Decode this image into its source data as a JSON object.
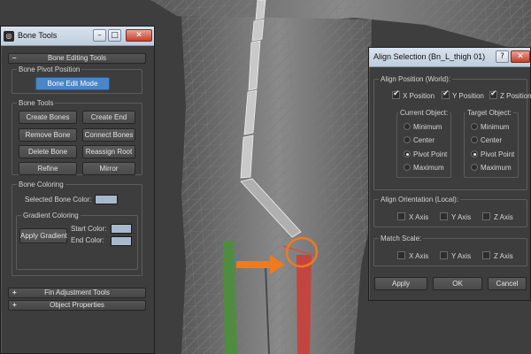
{
  "bone_tools": {
    "title": "Bone Tools",
    "rollout_bone_editing": "Bone Editing Tools",
    "pivot_group": "Bone Pivot Position",
    "bone_edit_mode": "Bone Edit Mode",
    "bone_tools_group": "Bone Tools",
    "create_bones": "Create Bones",
    "create_end": "Create End",
    "remove_bone": "Remove Bone",
    "connect_bones": "Connect Bones",
    "delete_bone": "Delete Bone",
    "reassign_root": "Reassign Root",
    "refine": "Refine",
    "mirror": "Mirror",
    "coloring_group": "Bone Coloring",
    "selected_bone_color": "Selected Bone Color:",
    "gradient_group": "Gradient Coloring",
    "apply_gradient": "Apply Gradient",
    "start_color": "Start Color:",
    "end_color": "End Color:",
    "rollout_fin": "Fin Adjustment Tools",
    "rollout_props": "Object Properties",
    "collapsed_sign": "+",
    "expanded_sign": "–",
    "swatch_color": "#a9b9cd"
  },
  "align": {
    "title": "Align Selection (Bn_L_thigh 01)",
    "help": "?",
    "close": "✕",
    "position_group": "Align Position (World):",
    "x_position": "X Position",
    "y_position": "Y Position",
    "z_position": "Z Position",
    "current_object": "Current Object:",
    "target_object": "Target Object:",
    "minimum": "Minimum",
    "center": "Center",
    "pivot_point": "Pivot Point",
    "maximum": "Maximum",
    "orientation_group": "Align Orientation (Local):",
    "x_axis": "X Axis",
    "y_axis": "Y Axis",
    "z_axis": "Z Axis",
    "scale_group": "Match Scale:",
    "apply": "Apply",
    "ok": "OK",
    "cancel": "Cancel"
  },
  "colors": {
    "viewport_bg": "#3e3e3e",
    "mesh": "#cfcfcf",
    "annotation_orange": "#f07a1e",
    "bone_red": "#c8413a",
    "bone_green": "#4d8f3b"
  }
}
